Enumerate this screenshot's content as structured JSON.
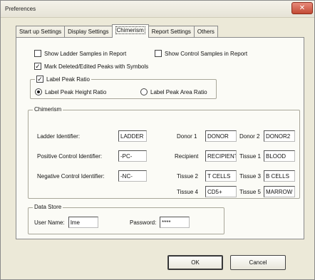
{
  "window": {
    "title": "Preferences",
    "close_glyph": "✕"
  },
  "tabs": [
    "Start up Settings",
    "Display Settings",
    "Chimerism",
    "Report Settings",
    "Others"
  ],
  "active_tab": "Chimerism",
  "options": {
    "show_ladder": {
      "label": "Show Ladder Samples in Report",
      "checked": false
    },
    "show_control": {
      "label": "Show Control Samples in Report",
      "checked": false
    },
    "mark_deleted": {
      "label": "Mark Deleted/Edited Peaks with Symbols",
      "checked": true
    },
    "label_peak_ratio": {
      "label": "Label Peak Ratio",
      "checked": true
    },
    "height_ratio": {
      "label": "Label Peak Height Ratio",
      "selected": true
    },
    "area_ratio": {
      "label": "Label Peak Area Ratio",
      "selected": false
    }
  },
  "chimerism": {
    "legend": "Chimerism",
    "ladder_label": "Ladder Identifier:",
    "ladder_value": "LADDER",
    "positive_label": "Positive Control Identifier:",
    "positive_value": "-PC-",
    "negative_label": "Negative Control Identifier:",
    "negative_value": "-NC-",
    "donor1_label": "Donor 1",
    "donor1_value": "DONOR",
    "donor2_label": "Donor 2",
    "donor2_value": "DONOR2",
    "recipient_label": "Recipient",
    "recipient_value": "RECIPIENT",
    "tissue1_label": "Tissue 1",
    "tissue1_value": "BLOOD",
    "tissue2_label": "Tissue 2",
    "tissue2_value": "T CELLS",
    "tissue3_label": "Tissue 3",
    "tissue3_value": "B CELLS",
    "tissue4_label": "Tissue 4",
    "tissue4_value": "CD5+",
    "tissue5_label": "Tissue 5",
    "tissue5_value": "MARROW"
  },
  "datastore": {
    "legend": "Data Store",
    "username_label": "User Name:",
    "username_value": "lme",
    "password_label": "Password:",
    "password_value": "****"
  },
  "buttons": {
    "ok": "OK",
    "cancel": "Cancel"
  }
}
